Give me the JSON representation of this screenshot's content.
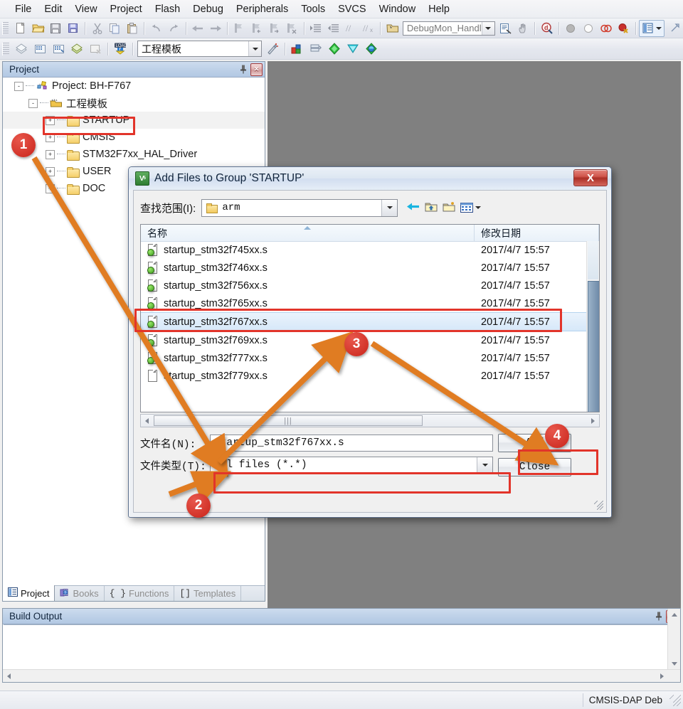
{
  "menu": {
    "items": [
      "File",
      "Edit",
      "View",
      "Project",
      "Flash",
      "Debug",
      "Peripherals",
      "Tools",
      "SVCS",
      "Window",
      "Help"
    ]
  },
  "toolbar1": {
    "debug_combo_value": "DebugMon_Handler",
    "icons": [
      "new-file-icon",
      "open-file-icon",
      "save-icon",
      "save-all-icon",
      "cut-icon",
      "copy-icon",
      "paste-icon",
      "undo-icon",
      "redo-icon",
      "back-icon",
      "forward-icon",
      "bookmark-toggle-icon",
      "bookmark-prev-icon",
      "bookmark-next-icon",
      "bookmark-clear-icon",
      "indent-icon",
      "outdent-icon",
      "comment-icon",
      "uncomment-icon",
      "function-browse-icon",
      "find-in-files-icon",
      "hand-icon",
      "debug-query-icon",
      "breakpoint-filled-icon",
      "breakpoint-empty-icon",
      "breakpoint-disable-icon",
      "breakpoint-kill-icon",
      "window-layout-icon"
    ]
  },
  "toolbar2": {
    "target_combo_value": "工程模板",
    "icons": [
      "translate-icon",
      "build-icon",
      "rebuild-icon",
      "batch-build-icon",
      "stop-build-icon",
      "download-icon",
      "target-options-icon",
      "manage-project-items-icon",
      "multi-project-icon",
      "pack-installer-icon",
      "run-time-env-icon",
      "configuration-wizard-icon"
    ]
  },
  "project_panel": {
    "title": "Project",
    "pin_icon": "pin-icon",
    "close_icon": "close-icon",
    "tree": [
      {
        "label": "Project: BH-F767",
        "depth": 0,
        "toggle": "-",
        "icon": "project-icon"
      },
      {
        "label": "工程模板",
        "depth": 1,
        "toggle": "-",
        "icon": "target-icon"
      },
      {
        "label": "STARTUP",
        "depth": 2,
        "toggle": "+",
        "icon": "folder-icon",
        "selected": true
      },
      {
        "label": "CMSIS",
        "depth": 2,
        "toggle": "+",
        "icon": "folder-icon"
      },
      {
        "label": "STM32F7xx_HAL_Driver",
        "depth": 2,
        "toggle": "+",
        "icon": "folder-icon"
      },
      {
        "label": "USER",
        "depth": 2,
        "toggle": "+",
        "icon": "folder-icon"
      },
      {
        "label": "DOC",
        "depth": 2,
        "toggle": "+",
        "icon": "folder-icon"
      }
    ],
    "tabs": [
      {
        "label": "Project",
        "icon": "project-tab-icon",
        "active": true
      },
      {
        "label": "Books",
        "icon": "books-tab-icon",
        "active": false
      },
      {
        "label": "Functions",
        "icon": "functions-tab-icon",
        "active": false
      },
      {
        "label": "Templates",
        "icon": "templates-tab-icon",
        "active": false
      }
    ]
  },
  "build_output": {
    "title": "Build Output",
    "pin_icon": "pin-icon",
    "close_icon": "close-icon",
    "content": ""
  },
  "status_bar": {
    "debugger": "CMSIS-DAP Deb"
  },
  "dialog": {
    "title": "Add Files to Group 'STARTUP'",
    "app_icon": "keil-uvision-icon",
    "close_label": "X",
    "look_in_label": "查找范围(I):",
    "look_in_value": "arm",
    "nav_icons": [
      "back-arrow-icon",
      "up-folder-icon",
      "new-folder-icon",
      "views-icon"
    ],
    "columns": [
      "名称",
      "修改日期"
    ],
    "files": [
      {
        "name": "startup_stm32f745xx.s",
        "date": "2017/4/7 15:57",
        "selected": false
      },
      {
        "name": "startup_stm32f746xx.s",
        "date": "2017/4/7 15:57",
        "selected": false
      },
      {
        "name": "startup_stm32f756xx.s",
        "date": "2017/4/7 15:57",
        "selected": false
      },
      {
        "name": "startup_stm32f765xx.s",
        "date": "2017/4/7 15:57",
        "selected": false
      },
      {
        "name": "startup_stm32f767xx.s",
        "date": "2017/4/7 15:57",
        "selected": true
      },
      {
        "name": "startup_stm32f769xx.s",
        "date": "2017/4/7 15:57",
        "selected": false
      },
      {
        "name": "startup_stm32f777xx.s",
        "date": "2017/4/7 15:57",
        "selected": false
      },
      {
        "name": "startup_stm32f779xx.s",
        "date": "2017/4/7 15:57",
        "selected": false
      }
    ],
    "file_name_label": "文件名(N):",
    "file_name_value": "startup_stm32f767xx.s",
    "file_type_label": "文件类型(T):",
    "file_type_value": "All files (*.*)",
    "add_button": "Add",
    "close_button": "Close"
  },
  "annotations": {
    "accent_color": "#e2342a",
    "arrow_color": "#e07b20",
    "markers": [
      {
        "label": "1"
      },
      {
        "label": "2"
      },
      {
        "label": "3"
      },
      {
        "label": "4"
      }
    ],
    "highlight_boxes": [
      "startup-tree-node",
      "selected-file-row",
      "file-type-combo",
      "add-button"
    ]
  }
}
